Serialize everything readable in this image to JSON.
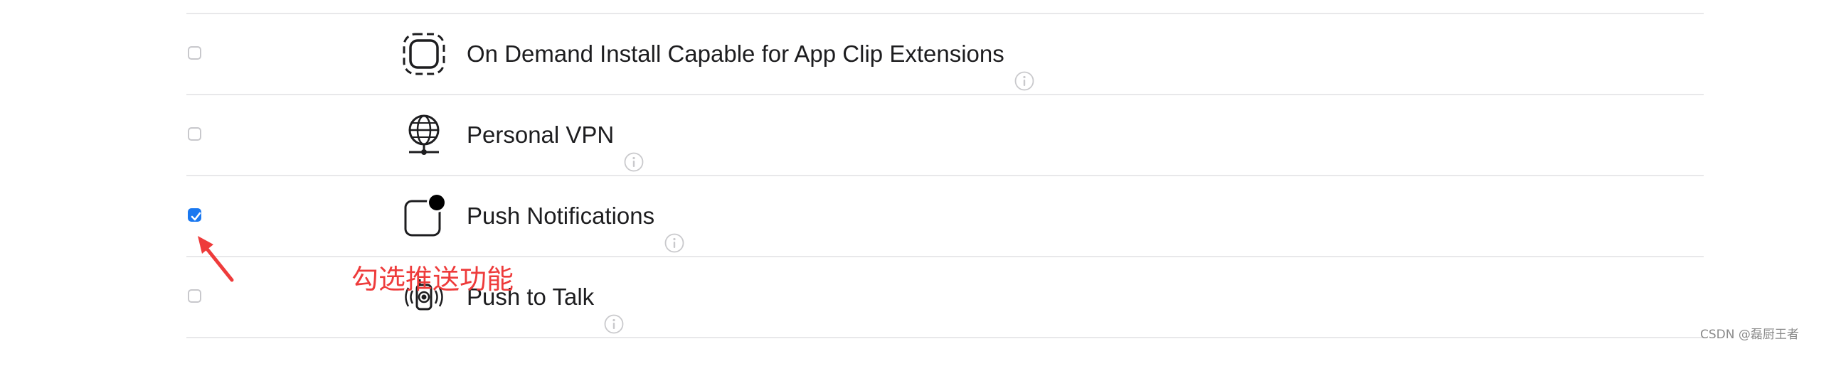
{
  "capabilities": [
    {
      "label": "On Demand Install Capable for App Clip Extensions",
      "checked": false,
      "icon": "app-clip-icon"
    },
    {
      "label": "Personal VPN",
      "checked": false,
      "icon": "globe-network-icon"
    },
    {
      "label": "Push Notifications",
      "checked": true,
      "icon": "notification-badge-icon"
    },
    {
      "label": "Push to Talk",
      "checked": false,
      "icon": "walkie-talkie-icon"
    }
  ],
  "annotation": {
    "text": "勾选推送功能",
    "color": "#ee3b3b"
  },
  "watermark": "CSDN @磊厨王者",
  "colors": {
    "accent": "#1a78f0",
    "divider": "#e8e8ea",
    "text": "#1d1d1f"
  }
}
